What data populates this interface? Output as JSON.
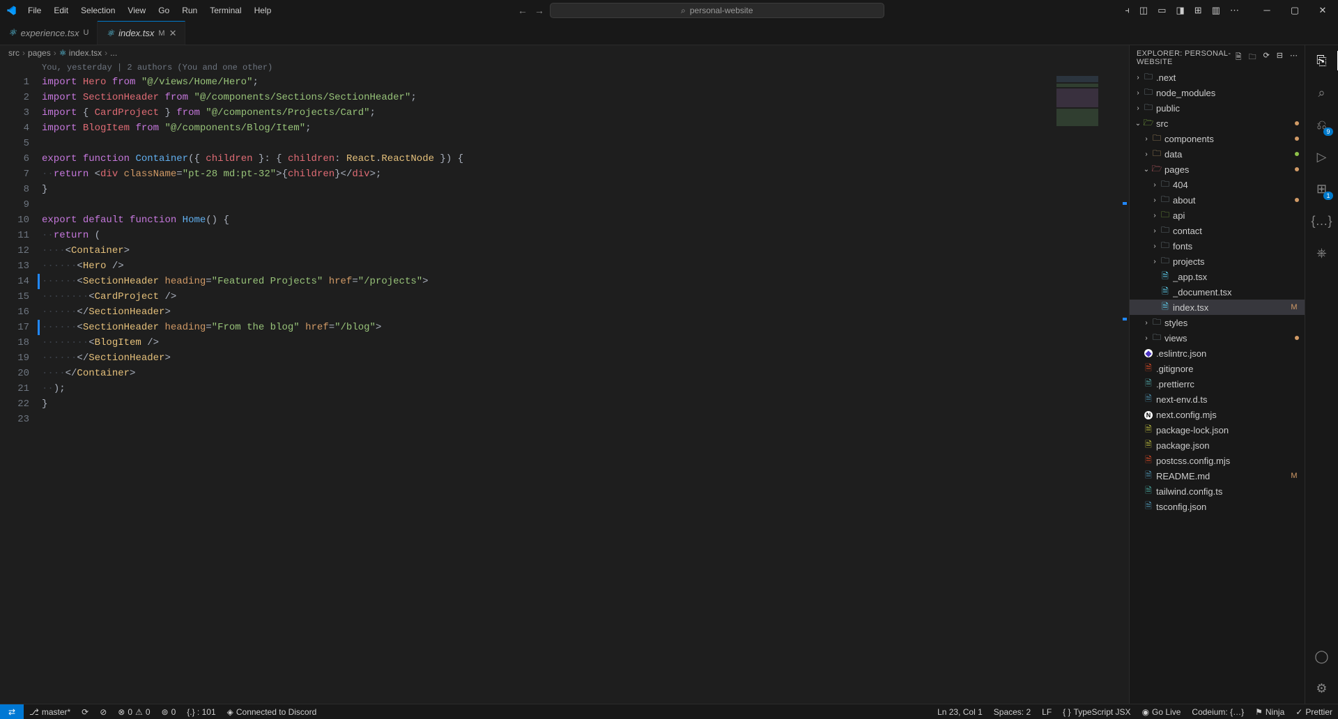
{
  "menu": [
    "File",
    "Edit",
    "Selection",
    "View",
    "Go",
    "Run",
    "Terminal",
    "Help"
  ],
  "command_center": "personal-website",
  "tabs": [
    {
      "icon": "react",
      "name": "experience.tsx",
      "status": "U",
      "active": false
    },
    {
      "icon": "react",
      "name": "index.tsx",
      "status": "M",
      "active": true,
      "close": true
    }
  ],
  "breadcrumb": [
    "src",
    "pages",
    "index.tsx",
    "..."
  ],
  "codelens": "You, yesterday | 2 authors (You and one other)",
  "code_lines": [
    {
      "n": 1,
      "html": "<span class='tok-kw'>import</span> <span class='tok-var'>Hero</span> <span class='tok-kw'>from</span> <span class='tok-str'>\"@/views/Home/Hero\"</span><span class='tok-punct'>;</span>"
    },
    {
      "n": 2,
      "html": "<span class='tok-kw'>import</span> <span class='tok-var'>SectionHeader</span> <span class='tok-kw'>from</span> <span class='tok-str'>\"@/components/Sections/SectionHeader\"</span><span class='tok-punct'>;</span>"
    },
    {
      "n": 3,
      "html": "<span class='tok-kw'>import</span> <span class='tok-punct'>{</span> <span class='tok-var'>CardProject</span> <span class='tok-punct'>}</span> <span class='tok-kw'>from</span> <span class='tok-str'>\"@/components/Projects/Card\"</span><span class='tok-punct'>;</span>"
    },
    {
      "n": 4,
      "html": "<span class='tok-kw'>import</span> <span class='tok-var'>BlogItem</span> <span class='tok-kw'>from</span> <span class='tok-str'>\"@/components/Blog/Item\"</span><span class='tok-punct'>;</span>"
    },
    {
      "n": 5,
      "html": ""
    },
    {
      "n": 6,
      "html": "<span class='tok-kw'>export</span> <span class='tok-kw'>function</span> <span class='tok-fn'>Container</span><span class='tok-punct'>({</span> <span class='tok-var'>children</span> <span class='tok-punct'>}: {</span> <span class='tok-var'>children</span><span class='tok-punct'>:</span> <span class='tok-type'>React</span><span class='tok-punct'>.</span><span class='tok-type'>ReactNode</span> <span class='tok-punct'>}) {</span>"
    },
    {
      "n": 7,
      "html": "<span class='tok-ws'>··</span><span class='tok-kw'>return</span> <span class='tok-punct'>&lt;</span><span class='tok-tag'>div</span> <span class='tok-attr'>className</span><span class='tok-punct'>=</span><span class='tok-str'>\"pt-28 md:pt-32\"</span><span class='tok-punct'>&gt;{</span><span class='tok-var'>children</span><span class='tok-punct'>}&lt;/</span><span class='tok-tag'>div</span><span class='tok-punct'>&gt;;</span>"
    },
    {
      "n": 8,
      "html": "<span class='tok-punct'>}</span>"
    },
    {
      "n": 9,
      "html": ""
    },
    {
      "n": 10,
      "html": "<span class='tok-kw'>export</span> <span class='tok-kw'>default</span> <span class='tok-kw'>function</span> <span class='tok-fn'>Home</span><span class='tok-punct'>() {</span>"
    },
    {
      "n": 11,
      "html": "<span class='tok-ws'>··</span><span class='tok-kw'>return</span> <span class='tok-punct'>(</span>"
    },
    {
      "n": 12,
      "html": "<span class='tok-ws'>····</span><span class='tok-punct'>&lt;</span><span class='tok-comp'>Container</span><span class='tok-punct'>&gt;</span>"
    },
    {
      "n": 13,
      "html": "<span class='tok-ws'>······</span><span class='tok-punct'>&lt;</span><span class='tok-comp'>Hero</span> <span class='tok-punct'>/&gt;</span>"
    },
    {
      "n": 14,
      "bar": true,
      "html": "<span class='tok-ws'>······</span><span class='tok-punct'>&lt;</span><span class='tok-comp'>SectionHeader</span> <span class='tok-attr'>heading</span><span class='tok-punct'>=</span><span class='tok-str'>\"Featured Projects\"</span> <span class='tok-attr'>href</span><span class='tok-punct'>=</span><span class='tok-str'>\"/projects\"</span><span class='tok-punct'>&gt;</span>"
    },
    {
      "n": 15,
      "html": "<span class='tok-ws'>········</span><span class='tok-punct'>&lt;</span><span class='tok-comp'>CardProject</span> <span class='tok-punct'>/&gt;</span>"
    },
    {
      "n": 16,
      "html": "<span class='tok-ws'>······</span><span class='tok-punct'>&lt;/</span><span class='tok-comp'>SectionHeader</span><span class='tok-punct'>&gt;</span>"
    },
    {
      "n": 17,
      "bar": true,
      "html": "<span class='tok-ws'>······</span><span class='tok-punct'>&lt;</span><span class='tok-comp'>SectionHeader</span> <span class='tok-attr'>heading</span><span class='tok-punct'>=</span><span class='tok-str'>\"From the blog\"</span> <span class='tok-attr'>href</span><span class='tok-punct'>=</span><span class='tok-str'>\"/blog\"</span><span class='tok-punct'>&gt;</span>"
    },
    {
      "n": 18,
      "html": "<span class='tok-ws'>········</span><span class='tok-punct'>&lt;</span><span class='tok-comp'>BlogItem</span> <span class='tok-punct'>/&gt;</span>"
    },
    {
      "n": 19,
      "html": "<span class='tok-ws'>······</span><span class='tok-punct'>&lt;/</span><span class='tok-comp'>SectionHeader</span><span class='tok-punct'>&gt;</span>"
    },
    {
      "n": 20,
      "html": "<span class='tok-ws'>····</span><span class='tok-punct'>&lt;/</span><span class='tok-comp'>Container</span><span class='tok-punct'>&gt;</span>"
    },
    {
      "n": 21,
      "html": "<span class='tok-ws'>··</span><span class='tok-punct'>);</span>"
    },
    {
      "n": 22,
      "html": "<span class='tok-punct'>}</span>"
    },
    {
      "n": 23,
      "html": ""
    }
  ],
  "explorer_title": "EXPLORER: PERSONAL-WEBSITE",
  "tree": [
    {
      "d": 0,
      "t": "folder",
      "exp": false,
      "name": ".next",
      "cls": "ic-folder"
    },
    {
      "d": 0,
      "t": "folder",
      "exp": false,
      "name": "node_modules",
      "cls": "ic-folder"
    },
    {
      "d": 0,
      "t": "folder",
      "exp": false,
      "name": "public",
      "cls": "ic-folder"
    },
    {
      "d": 0,
      "t": "folder",
      "exp": true,
      "name": "src",
      "cls": "ic-folder-src",
      "dot": "#d19a66"
    },
    {
      "d": 1,
      "t": "folder",
      "exp": false,
      "name": "components",
      "cls": "ic-folder-comp",
      "dot": "#d19a66"
    },
    {
      "d": 1,
      "t": "folder",
      "exp": false,
      "name": "data",
      "cls": "ic-folder-open",
      "dot": "#8dc149"
    },
    {
      "d": 1,
      "t": "folder",
      "exp": true,
      "name": "pages",
      "cls": "ic-folder-pages",
      "dot": "#d19a66"
    },
    {
      "d": 2,
      "t": "folder",
      "exp": false,
      "name": "404",
      "cls": "ic-folder"
    },
    {
      "d": 2,
      "t": "folder",
      "exp": false,
      "name": "about",
      "cls": "ic-folder",
      "dot": "#d19a66"
    },
    {
      "d": 2,
      "t": "folder",
      "exp": false,
      "name": "api",
      "cls": "ic-folder-api"
    },
    {
      "d": 2,
      "t": "folder",
      "exp": false,
      "name": "contact",
      "cls": "ic-folder"
    },
    {
      "d": 2,
      "t": "folder",
      "exp": false,
      "name": "fonts",
      "cls": "ic-folder"
    },
    {
      "d": 2,
      "t": "folder",
      "exp": false,
      "name": "projects",
      "cls": "ic-folder"
    },
    {
      "d": 2,
      "t": "file",
      "name": "_app.tsx",
      "cls": "ic-react"
    },
    {
      "d": 2,
      "t": "file",
      "name": "_document.tsx",
      "cls": "ic-react"
    },
    {
      "d": 2,
      "t": "file",
      "name": "index.tsx",
      "cls": "ic-react",
      "badge": "M",
      "selected": true
    },
    {
      "d": 1,
      "t": "folder",
      "exp": false,
      "name": "styles",
      "cls": "ic-folder"
    },
    {
      "d": 1,
      "t": "folder",
      "exp": false,
      "name": "views",
      "cls": "ic-folder",
      "dot": "#d19a66"
    },
    {
      "d": 0,
      "t": "file",
      "name": ".eslintrc.json",
      "cls": "ic-eslint"
    },
    {
      "d": 0,
      "t": "file",
      "name": ".gitignore",
      "cls": "ic-git"
    },
    {
      "d": 0,
      "t": "file",
      "name": ".prettierrc",
      "cls": "ic-prettier"
    },
    {
      "d": 0,
      "t": "file",
      "name": "next-env.d.ts",
      "cls": "ic-ts"
    },
    {
      "d": 0,
      "t": "file",
      "name": "next.config.mjs",
      "cls": "ic-next"
    },
    {
      "d": 0,
      "t": "file",
      "name": "package-lock.json",
      "cls": "ic-json"
    },
    {
      "d": 0,
      "t": "file",
      "name": "package.json",
      "cls": "ic-json"
    },
    {
      "d": 0,
      "t": "file",
      "name": "postcss.config.mjs",
      "cls": "ic-postcss"
    },
    {
      "d": 0,
      "t": "file",
      "name": "README.md",
      "cls": "ic-md",
      "badge": "M"
    },
    {
      "d": 0,
      "t": "file",
      "name": "tailwind.config.ts",
      "cls": "ic-tailwind"
    },
    {
      "d": 0,
      "t": "file",
      "name": "tsconfig.json",
      "cls": "ic-ts"
    }
  ],
  "activity": [
    {
      "name": "explorer",
      "icon": "⎘",
      "active": true
    },
    {
      "name": "search",
      "icon": "⌕"
    },
    {
      "name": "source-control",
      "icon": "⎌",
      "badge": "9"
    },
    {
      "name": "run-debug",
      "icon": "▷"
    },
    {
      "name": "extensions",
      "icon": "⊞",
      "badge": "1"
    },
    {
      "name": "bracket",
      "icon": "{…}"
    },
    {
      "name": "remote",
      "icon": "⎈"
    }
  ],
  "activity_bottom": [
    {
      "name": "account",
      "icon": "◯"
    },
    {
      "name": "settings",
      "icon": "⚙"
    }
  ],
  "status": {
    "branch": "master*",
    "sync": "⟳",
    "ports": "⊘",
    "errors": "0",
    "warnings": "0",
    "radio": "0",
    "sel": "{.} : 101",
    "discord": "Connected to Discord",
    "ln": "Ln 23, Col 1",
    "spaces": "Spaces: 2",
    "eol": "LF",
    "lang_icon": "{ }",
    "lang": "TypeScript JSX",
    "golive": "Go Live",
    "codeium": "Codeium: {…}",
    "ninja": "Ninja",
    "prettier": "Prettier"
  }
}
